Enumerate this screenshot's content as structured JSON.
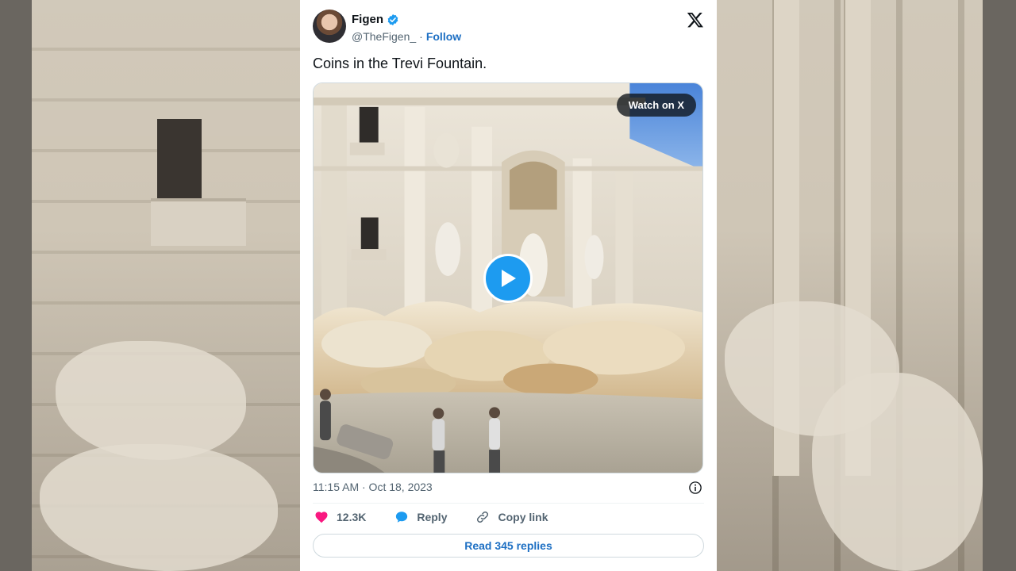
{
  "tweet": {
    "author_name": "Figen",
    "handle": "@TheFigen_",
    "separator": "·",
    "follow_label": "Follow",
    "text": "Coins in the Trevi Fountain.",
    "timestamp": "11:15 AM · Oct 18, 2023",
    "watch_label": "Watch on X",
    "accent_color": "#1d9bf0",
    "like_color": "#f91880",
    "icons": {
      "verified": "verified-badge-icon",
      "close": "x-logo-icon",
      "play": "play-icon",
      "info": "info-icon",
      "like": "heart-icon",
      "reply": "speech-bubble-icon",
      "copy": "link-icon"
    }
  },
  "actions": {
    "likes": "12.3K",
    "reply_label": "Reply",
    "copy_label": "Copy link"
  },
  "footer": {
    "read_replies_label": "Read 345 replies"
  }
}
